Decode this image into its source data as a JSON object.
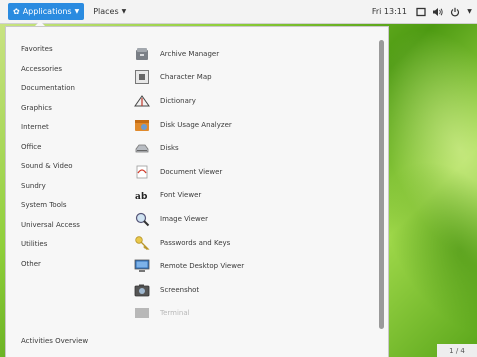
{
  "topbar": {
    "applications_label": "Applications",
    "places_label": "Places",
    "clock": "Fri 13:11"
  },
  "menu": {
    "categories": [
      "Favorites",
      "Accessories",
      "Documentation",
      "Graphics",
      "Internet",
      "Office",
      "Sound & Video",
      "Sundry",
      "System Tools",
      "Universal Access",
      "Utilities",
      "Other"
    ],
    "activities_overview": "Activities Overview",
    "apps": [
      {
        "label": "Archive Manager",
        "icon": "archive-icon"
      },
      {
        "label": "Character Map",
        "icon": "character-map-icon"
      },
      {
        "label": "Dictionary",
        "icon": "dictionary-icon"
      },
      {
        "label": "Disk Usage Analyzer",
        "icon": "disk-usage-icon"
      },
      {
        "label": "Disks",
        "icon": "disks-icon"
      },
      {
        "label": "Document Viewer",
        "icon": "document-viewer-icon"
      },
      {
        "label": "Font Viewer",
        "icon": "font-viewer-icon"
      },
      {
        "label": "Image Viewer",
        "icon": "image-viewer-icon"
      },
      {
        "label": "Passwords and Keys",
        "icon": "passwords-keys-icon"
      },
      {
        "label": "Remote Desktop Viewer",
        "icon": "remote-desktop-icon"
      },
      {
        "label": "Screenshot",
        "icon": "screenshot-icon"
      },
      {
        "label": "Terminal",
        "icon": "terminal-icon"
      }
    ]
  },
  "page_indicator": "1 / 4",
  "colors": {
    "accent": "#2a8be0",
    "wallpaper": "#6fbf2a"
  }
}
